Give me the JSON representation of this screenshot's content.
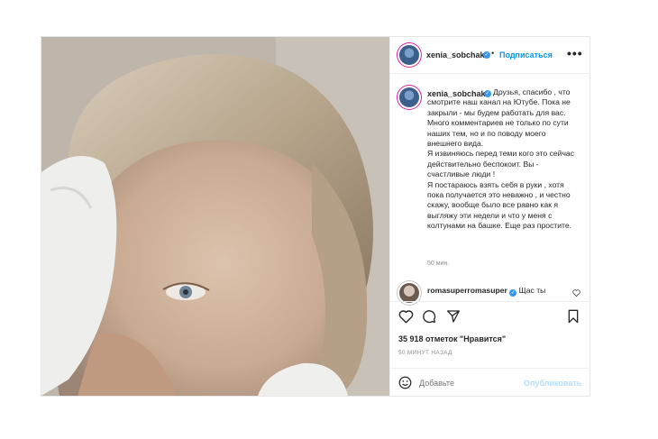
{
  "post": {
    "author": "xenia_sobchak",
    "follow_label": "Подписаться",
    "separator": "•",
    "more_label": "•••",
    "caption_author": "xenia_sobchak",
    "caption": "Друзья, спасибо , что смотрите наш канал на Ютубе. Пока не закрыли - мы будем работать для вас. Много комментариев не только по сути наших тем, но и по поводу моего внешнего вида.\nЯ извиняюсь перед теми кого это сейчас действительно беспокоит. Вы - счастливые люди !\nЯ постараюсь взять себя в руки , хотя пока получается это неважно , и честно скажу, вообще было все равно как я выгляжу эти недели и что у меня с колтунами на башке. Еще раз простите.",
    "caption_time": "50 мин.",
    "comment": {
      "author": "romasuperromasuper",
      "text": "Щас ты"
    },
    "likes": "35 918 отметок \"Нравится\"",
    "posted_ago": "50 МИНУТ НАЗАД",
    "add_comment_placeholder": "Добавьте",
    "publish_label": "Опубликовать"
  },
  "icons": [
    "heart-icon",
    "comment-icon",
    "share-icon",
    "bookmark-icon",
    "smile-icon",
    "verified-icon"
  ],
  "colors": {
    "link_blue": "#0095f6",
    "verified_blue": "#3897f0",
    "muted": "#8e8e8e"
  }
}
